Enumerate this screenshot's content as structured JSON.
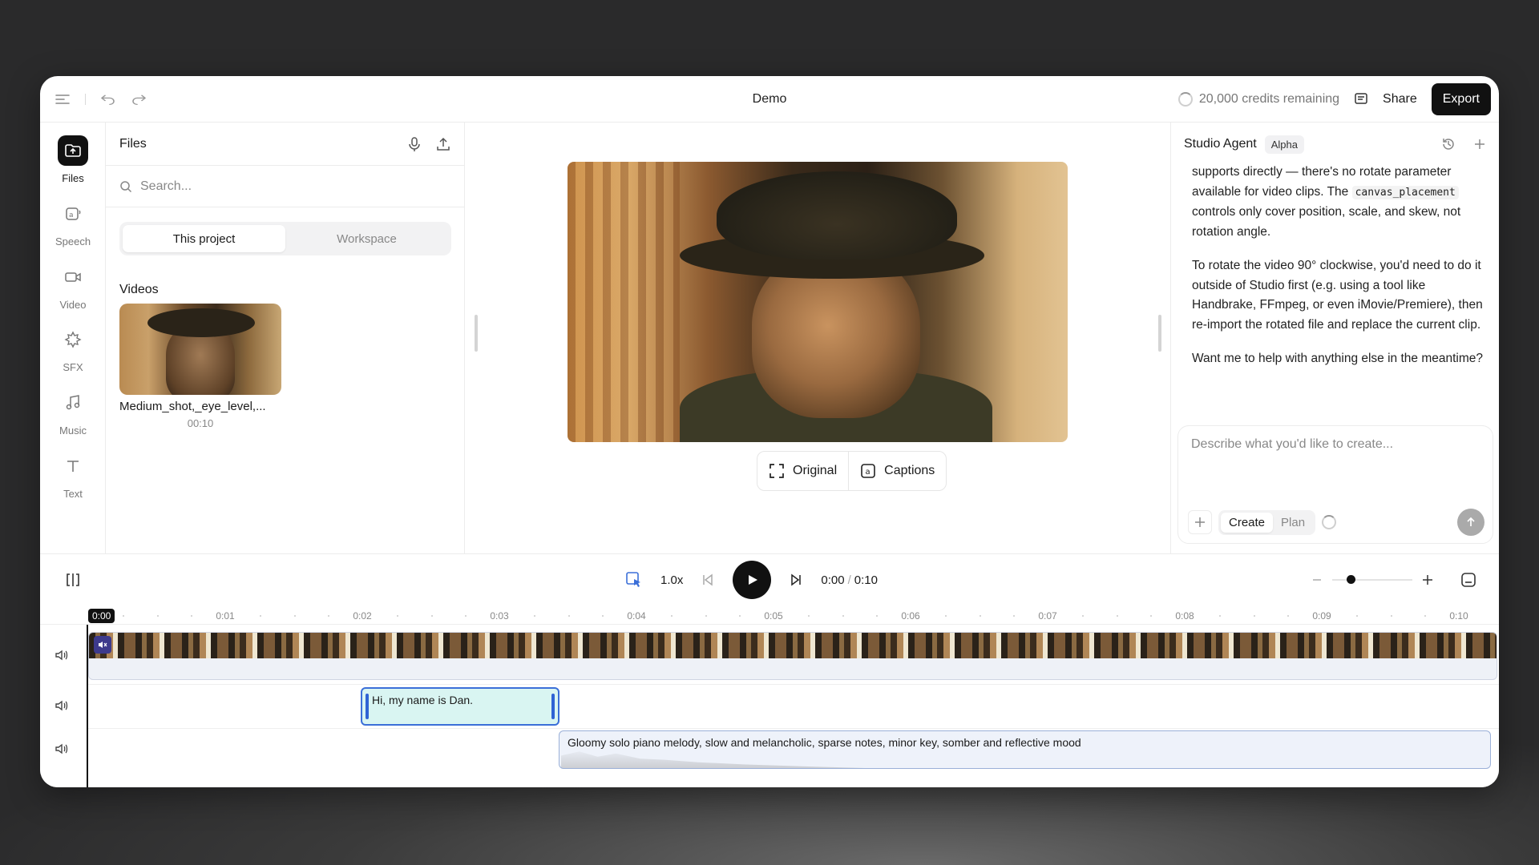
{
  "topbar": {
    "title": "Demo",
    "credits": "20,000 credits remaining",
    "share_label": "Share",
    "export_label": "Export"
  },
  "nav": [
    {
      "label": "Files",
      "icon": "upload-folder-icon",
      "active": true
    },
    {
      "label": "Speech",
      "icon": "speech-icon"
    },
    {
      "label": "Video",
      "icon": "video-camera-icon"
    },
    {
      "label": "SFX",
      "icon": "sfx-icon"
    },
    {
      "label": "Music",
      "icon": "music-note-icon"
    },
    {
      "label": "Text",
      "icon": "text-icon"
    }
  ],
  "files": {
    "title": "Files",
    "search_placeholder": "Search...",
    "tabs": [
      {
        "label": "This project",
        "active": true
      },
      {
        "label": "Workspace"
      }
    ],
    "section": "Videos",
    "video_name": "Medium_shot,_eye_level,...",
    "video_duration": "00:10"
  },
  "preview": {
    "original_label": "Original",
    "captions_label": "Captions"
  },
  "agent": {
    "title": "Studio Agent",
    "badge": "Alpha",
    "msg1_pre": "supports directly — there's no rotate parameter available for video clips. The ",
    "msg1_code": "canvas_placement",
    "msg1_post": " controls only cover position, scale, and skew, not rotation angle.",
    "msg2": "To rotate the video 90° clockwise, you'd need to do it outside of Studio first (e.g. using a tool like Handbrake, FFmpeg, or even iMovie/Premiere), then re-import the rotated file and replace the current clip.",
    "msg3": "Want me to help with anything else in the meantime?",
    "input_placeholder": "Describe what you'd like to create...",
    "mode_create": "Create",
    "mode_plan": "Plan"
  },
  "timeline": {
    "speed": "1.0x",
    "current_time": "0:00",
    "separator": "/",
    "total_time": "0:10",
    "playhead": "0:00",
    "ticks": [
      "0:01",
      "0:02",
      "0:03",
      "0:04",
      "0:05",
      "0:06",
      "0:07",
      "0:08",
      "0:09",
      "0:10"
    ],
    "speech_clip": "Hi, my name is Dan.",
    "music_clip": "Gloomy solo piano melody, slow and melancholic, sparse notes, minor key, somber and reflective mood"
  },
  "colors": {
    "accent": "#111111",
    "speech_clip_border": "#3b6fd8",
    "speech_clip_bg": "#d9f5f2",
    "music_clip_bg": "#eef2fa"
  }
}
